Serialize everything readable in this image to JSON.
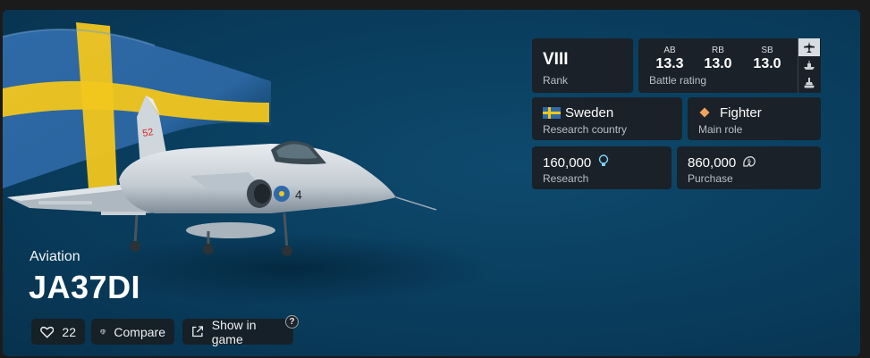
{
  "vehicle": {
    "category": "Aviation",
    "name": "JA37DI",
    "favorites_count": "22",
    "compare_label": "Compare",
    "show_in_game_label": "Show in game",
    "help_glyph": "?",
    "fin_number": "52",
    "nose_number": "4"
  },
  "stats": {
    "rank": {
      "value": "VIII",
      "label": "Rank"
    },
    "battle_rating": {
      "label": "Battle rating",
      "modes": [
        {
          "abbr": "AB",
          "value": "13.3"
        },
        {
          "abbr": "RB",
          "value": "13.0"
        },
        {
          "abbr": "SB",
          "value": "13.0"
        }
      ]
    },
    "country": {
      "value": "Sweden",
      "label": "Research country"
    },
    "role": {
      "value": "Fighter",
      "label": "Main role"
    },
    "research": {
      "value": "160,000",
      "label": "Research"
    },
    "purchase": {
      "value": "860,000",
      "label": "Purchase"
    }
  },
  "vehicle_type_tabs": [
    "plane-icon",
    "ship-icon",
    "tank-icon"
  ],
  "colors": {
    "background": "#0a3f60",
    "panel": "#1a2128",
    "sweden_blue": "#2f6aa8",
    "sweden_yellow": "#f1c61d",
    "role_orange": "#f0a060"
  }
}
